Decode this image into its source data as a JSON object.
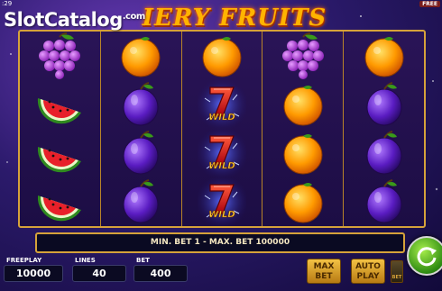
{
  "status": {
    "time_fragment": ":29",
    "free_label": "FREE"
  },
  "watermark": {
    "main": "SlotCatalog",
    "sub": ".com"
  },
  "game": {
    "title": "IERY FRUITS"
  },
  "reels": [
    [
      "grapes",
      "watermelon",
      "watermelon",
      "watermelon"
    ],
    [
      "orange",
      "plum",
      "plum",
      "plum"
    ],
    [
      "orange",
      "wild-seven",
      "wild-seven",
      "wild-seven"
    ],
    [
      "grapes",
      "orange",
      "orange",
      "orange"
    ],
    [
      "orange",
      "plum",
      "plum",
      "plum"
    ]
  ],
  "wild_label": "WILD",
  "info_bar": {
    "text": "MIN. BET 1 - MAX. BET 100000"
  },
  "fields": {
    "freeplay": {
      "label": "FREEPLAY",
      "value": "10000"
    },
    "lines": {
      "label": "LINES",
      "value": "40"
    },
    "bet": {
      "label": "BET",
      "value": "400"
    }
  },
  "buttons": {
    "max_bet": "MAX BET",
    "auto_play": "AUTO PLAY",
    "bet_small": "BET"
  },
  "colors": {
    "frame_gold": "#d6a23a",
    "spin_green": "#2e8b12",
    "background_purple": "#2b1a6b"
  }
}
